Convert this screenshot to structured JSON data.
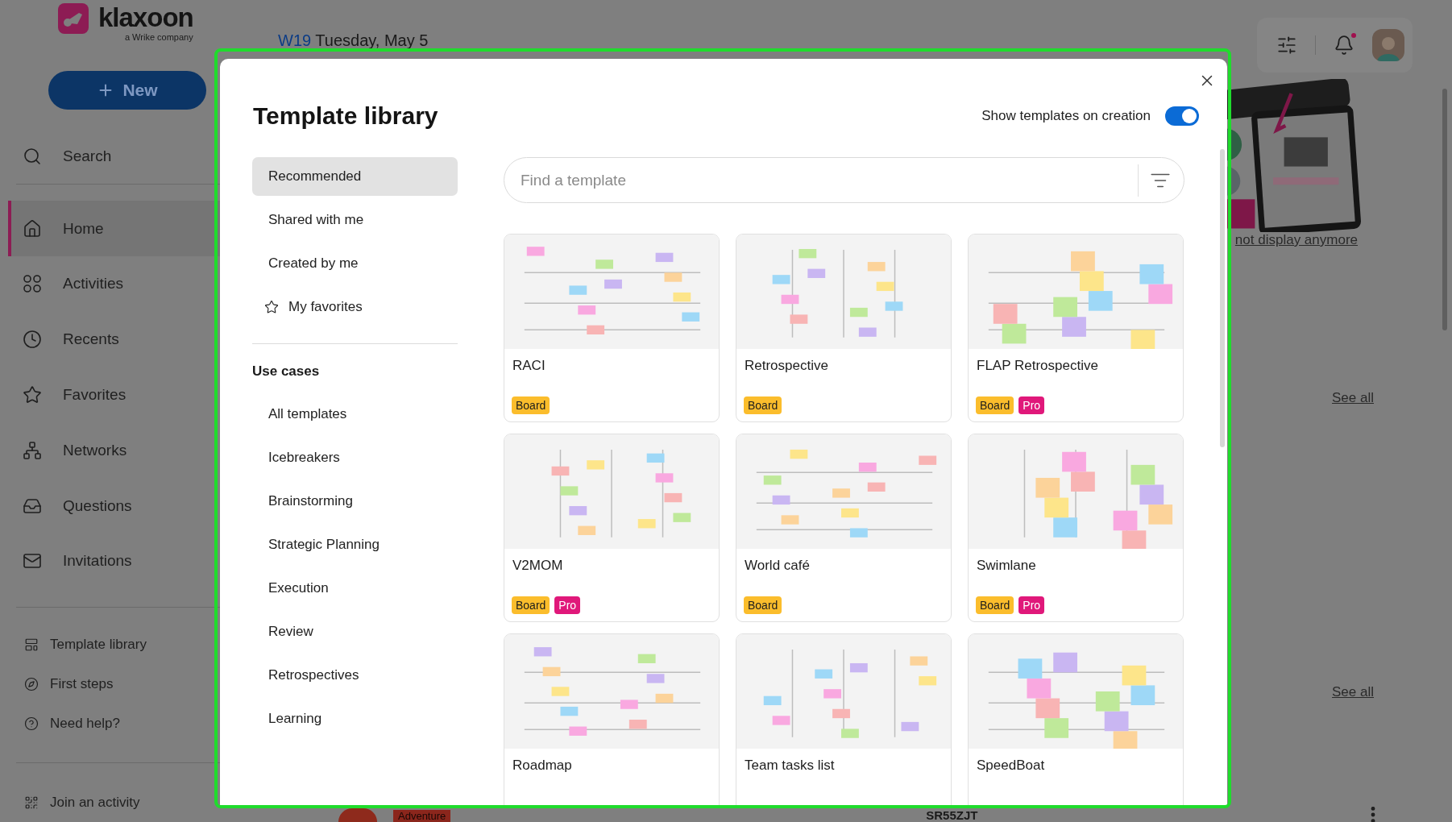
{
  "sidebar": {
    "logo": {
      "name": "klaxoon",
      "tagline": "a Wrike company"
    },
    "new_button": "New",
    "search": "Search",
    "nav_items": [
      {
        "label": "Home",
        "selected": true
      },
      {
        "label": "Activities",
        "selected": false
      },
      {
        "label": "Recents",
        "selected": false
      },
      {
        "label": "Favorites",
        "selected": false
      },
      {
        "label": "Networks",
        "selected": false
      },
      {
        "label": "Questions",
        "selected": false
      },
      {
        "label": "Invitations",
        "selected": false
      }
    ],
    "footer_links": [
      "Template library",
      "First steps",
      "Need help?"
    ],
    "join": "Join an activity"
  },
  "header": {
    "week": "W19",
    "date": "Tuesday, May 5"
  },
  "top_bar": {
    "notifications_unread": true
  },
  "background": {
    "banner_link": "not display anymore",
    "see_all": [
      "See all",
      "See all"
    ],
    "bottom_row": {
      "tag": "Adventure",
      "code": "SR55ZJT"
    }
  },
  "modal": {
    "title": "Template library",
    "toggle": {
      "label": "Show templates on creation",
      "on": true
    },
    "nav": [
      {
        "label": "Recommended",
        "selected": true,
        "kind": "plain"
      },
      {
        "label": "Shared with me",
        "selected": false,
        "kind": "plain"
      },
      {
        "label": "Created by me",
        "selected": false,
        "kind": "plain"
      },
      {
        "label": "My favorites",
        "selected": false,
        "kind": "starred"
      }
    ],
    "use_cases": {
      "heading": "Use cases",
      "items": [
        {
          "label": "All templates",
          "selected": false
        },
        {
          "label": "Icebreakers",
          "selected": false
        },
        {
          "label": "Brainstorming",
          "selected": false
        },
        {
          "label": "Strategic Planning",
          "selected": false
        },
        {
          "label": "Execution",
          "selected": false
        },
        {
          "label": "Review",
          "selected": false
        },
        {
          "label": "Retrospectives",
          "selected": false
        },
        {
          "label": "Learning",
          "selected": false
        }
      ]
    },
    "search": {
      "placeholder": "Find a template"
    },
    "templates": [
      {
        "title": "RACI",
        "badges": [
          {
            "label": "Board",
            "kind": "board"
          }
        ]
      },
      {
        "title": "Retrospective",
        "badges": [
          {
            "label": "Board",
            "kind": "board"
          }
        ]
      },
      {
        "title": "FLAP Retrospective",
        "badges": [
          {
            "label": "Board",
            "kind": "board"
          },
          {
            "label": "Pro",
            "kind": "pro"
          }
        ]
      },
      {
        "title": "V2MOM",
        "badges": [
          {
            "label": "Board",
            "kind": "board"
          },
          {
            "label": "Pro",
            "kind": "pro"
          }
        ]
      },
      {
        "title": "World café",
        "badges": [
          {
            "label": "Board",
            "kind": "board"
          }
        ]
      },
      {
        "title": "Swimlane",
        "badges": [
          {
            "label": "Board",
            "kind": "board"
          },
          {
            "label": "Pro",
            "kind": "pro"
          }
        ]
      },
      {
        "title": "Roadmap"
      },
      {
        "title": "Team tasks list"
      },
      {
        "title": "SpeedBoat"
      }
    ]
  }
}
